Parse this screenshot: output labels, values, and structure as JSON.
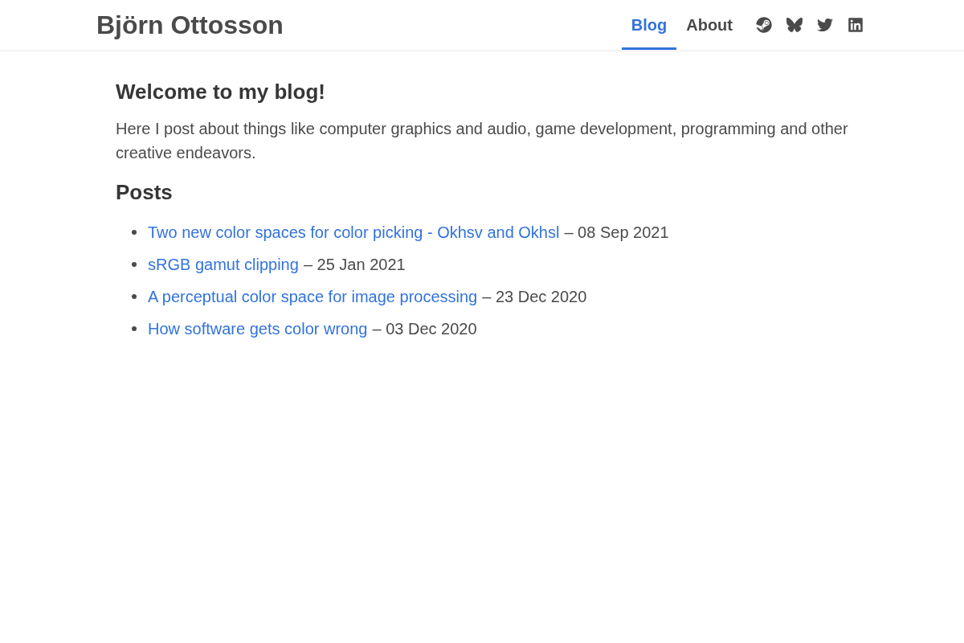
{
  "header": {
    "site_title": "Björn Ottosson",
    "nav": [
      {
        "label": "Blog",
        "selected": true
      },
      {
        "label": "About",
        "selected": false
      }
    ],
    "social_links": [
      {
        "kind": "steam"
      },
      {
        "kind": "bluesky"
      },
      {
        "kind": "twitter"
      },
      {
        "kind": "linkedin"
      }
    ]
  },
  "main": {
    "heading": "Welcome to my blog!",
    "intro": "Here I post about things like computer graphics and audio, game development, programming and other creative endeavors.",
    "posts_heading": "Posts",
    "posts": [
      {
        "title": "Two new color spaces for color picking - Okhsv and Okhsl",
        "date": "– 08 Sep 2021"
      },
      {
        "title": "sRGB gamut clipping",
        "date": "– 25 Jan 2021"
      },
      {
        "title": "A perceptual color space for image processing",
        "date": "– 23 Dec 2020"
      },
      {
        "title": "How software gets color wrong",
        "date": "– 03 Dec 2020"
      }
    ]
  }
}
